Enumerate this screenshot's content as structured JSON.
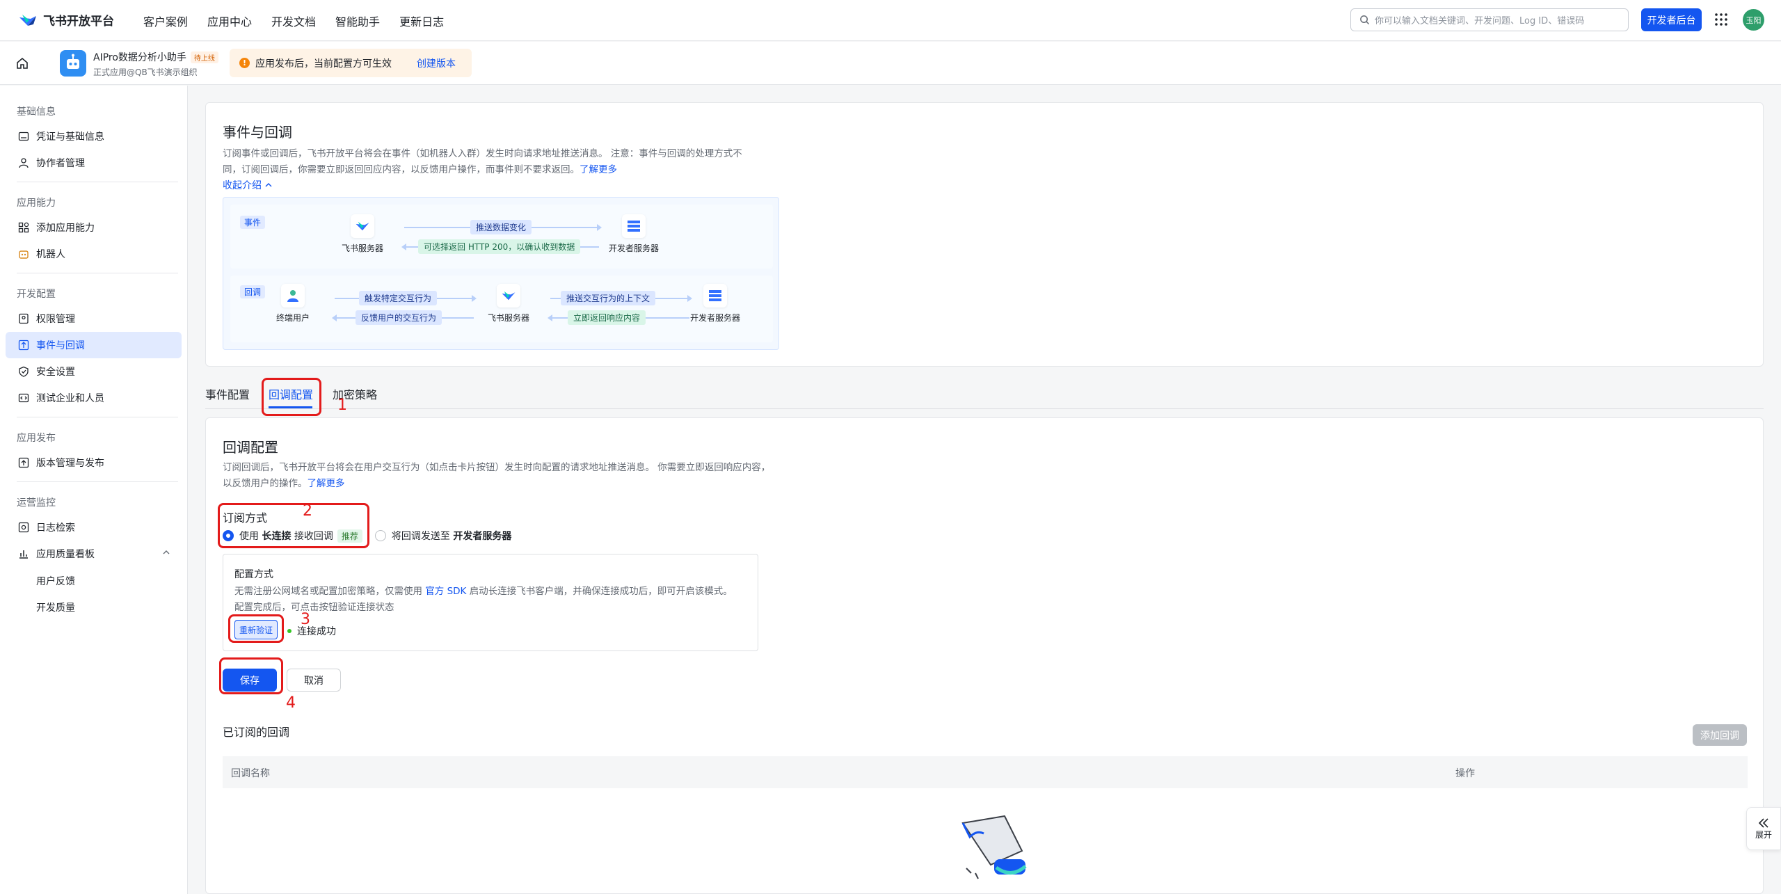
{
  "topbar": {
    "brand": "飞书开放平台",
    "nav": [
      "客户案例",
      "应用中心",
      "开发文档",
      "智能助手",
      "更新日志"
    ],
    "search_placeholder": "你可以输入文档关键词、开发问题、Log ID、错误码",
    "dev_console_label": "开发者后台",
    "avatar_text": "玉阳"
  },
  "appbar": {
    "app_name": "AIPro数据分析小助手",
    "app_status": "待上线",
    "app_sub": "正式应用@QB飞书演示组织",
    "notice_text": "应用发布后，当前配置方可生效",
    "notice_link": "创建版本"
  },
  "sidebar": {
    "groups": {
      "basic": "基础信息",
      "ability": "应用能力",
      "dev": "开发配置",
      "release": "应用发布",
      "ops": "运营监控"
    },
    "items": {
      "credentials": "凭证与基础信息",
      "collaborators": "协作者管理",
      "add_ability": "添加应用能力",
      "bot": "机器人",
      "permissions": "权限管理",
      "events": "事件与回调",
      "security": "安全设置",
      "test_org": "测试企业和人员",
      "versions": "版本管理与发布",
      "logs": "日志检索",
      "quality": "应用质量看板",
      "feedback": "用户反馈",
      "dev_quality": "开发质量"
    }
  },
  "intro": {
    "title": "事件与回调",
    "desc": "订阅事件或回调后，飞书开放平台将会在事件（如机器人入群）发生时向请求地址推送消息。 注意：事件与回调的处理方式不同，订阅回调后，你需要立即返回回应内容，以反馈用户操作，而事件则不要求返回。",
    "learn_more": "了解更多",
    "collapse": "收起介绍",
    "event_tag": "事件",
    "callback_tag": "回调",
    "feishu_server": "飞书服务器",
    "dev_server": "开发者服务器",
    "end_user": "终端用户",
    "event_push": "推送数据变化",
    "event_return": "可选择返回 HTTP 200，以确认收到数据",
    "cb_trigger": "触发特定交互行为",
    "cb_feedback": "反馈用户的交互行为",
    "cb_push": "推送交互行为的上下文",
    "cb_return": "立即返回响应内容"
  },
  "tabs": [
    "事件配置",
    "回调配置",
    "加密策略"
  ],
  "callback": {
    "title": "回调配置",
    "desc": "订阅回调后，飞书开放平台将会在用户交互行为（如点击卡片按钮）发生时向配置的请求地址推送消息。 你需要立即返回响应内容，以反馈用户的操作。",
    "learn_more": "了解更多",
    "sub_mode_title": "订阅方式",
    "option1_prefix": "使用 ",
    "option1_bold": "长连接",
    "option1_suffix": " 接收回调",
    "option1_tag": "推荐",
    "option2_prefix": "将回调发送至 ",
    "option2_bold": "开发者服务器",
    "cfg_title": "配置方式",
    "cfg_desc1": "无需注册公网域名或配置加密策略，仅需使用 ",
    "cfg_sdk": "官方 SDK",
    "cfg_desc2": " 启动长连接飞书客户端，并确保连接成功后，即可开启该模式。",
    "cfg_desc3": "配置完成后，可点击按钮验证连接状态",
    "reverify": "重新验证",
    "connected": "连接成功",
    "save": "保存",
    "cancel": "取消",
    "subscribed_title": "已订阅的回调",
    "add_callback": "添加回调",
    "col_name": "回调名称",
    "col_action": "操作"
  },
  "annotations": [
    "1",
    "2",
    "3",
    "4"
  ],
  "expand_label": "展开",
  "colors": {
    "primary": "#1456f0",
    "annotation": "#e31b1b"
  }
}
